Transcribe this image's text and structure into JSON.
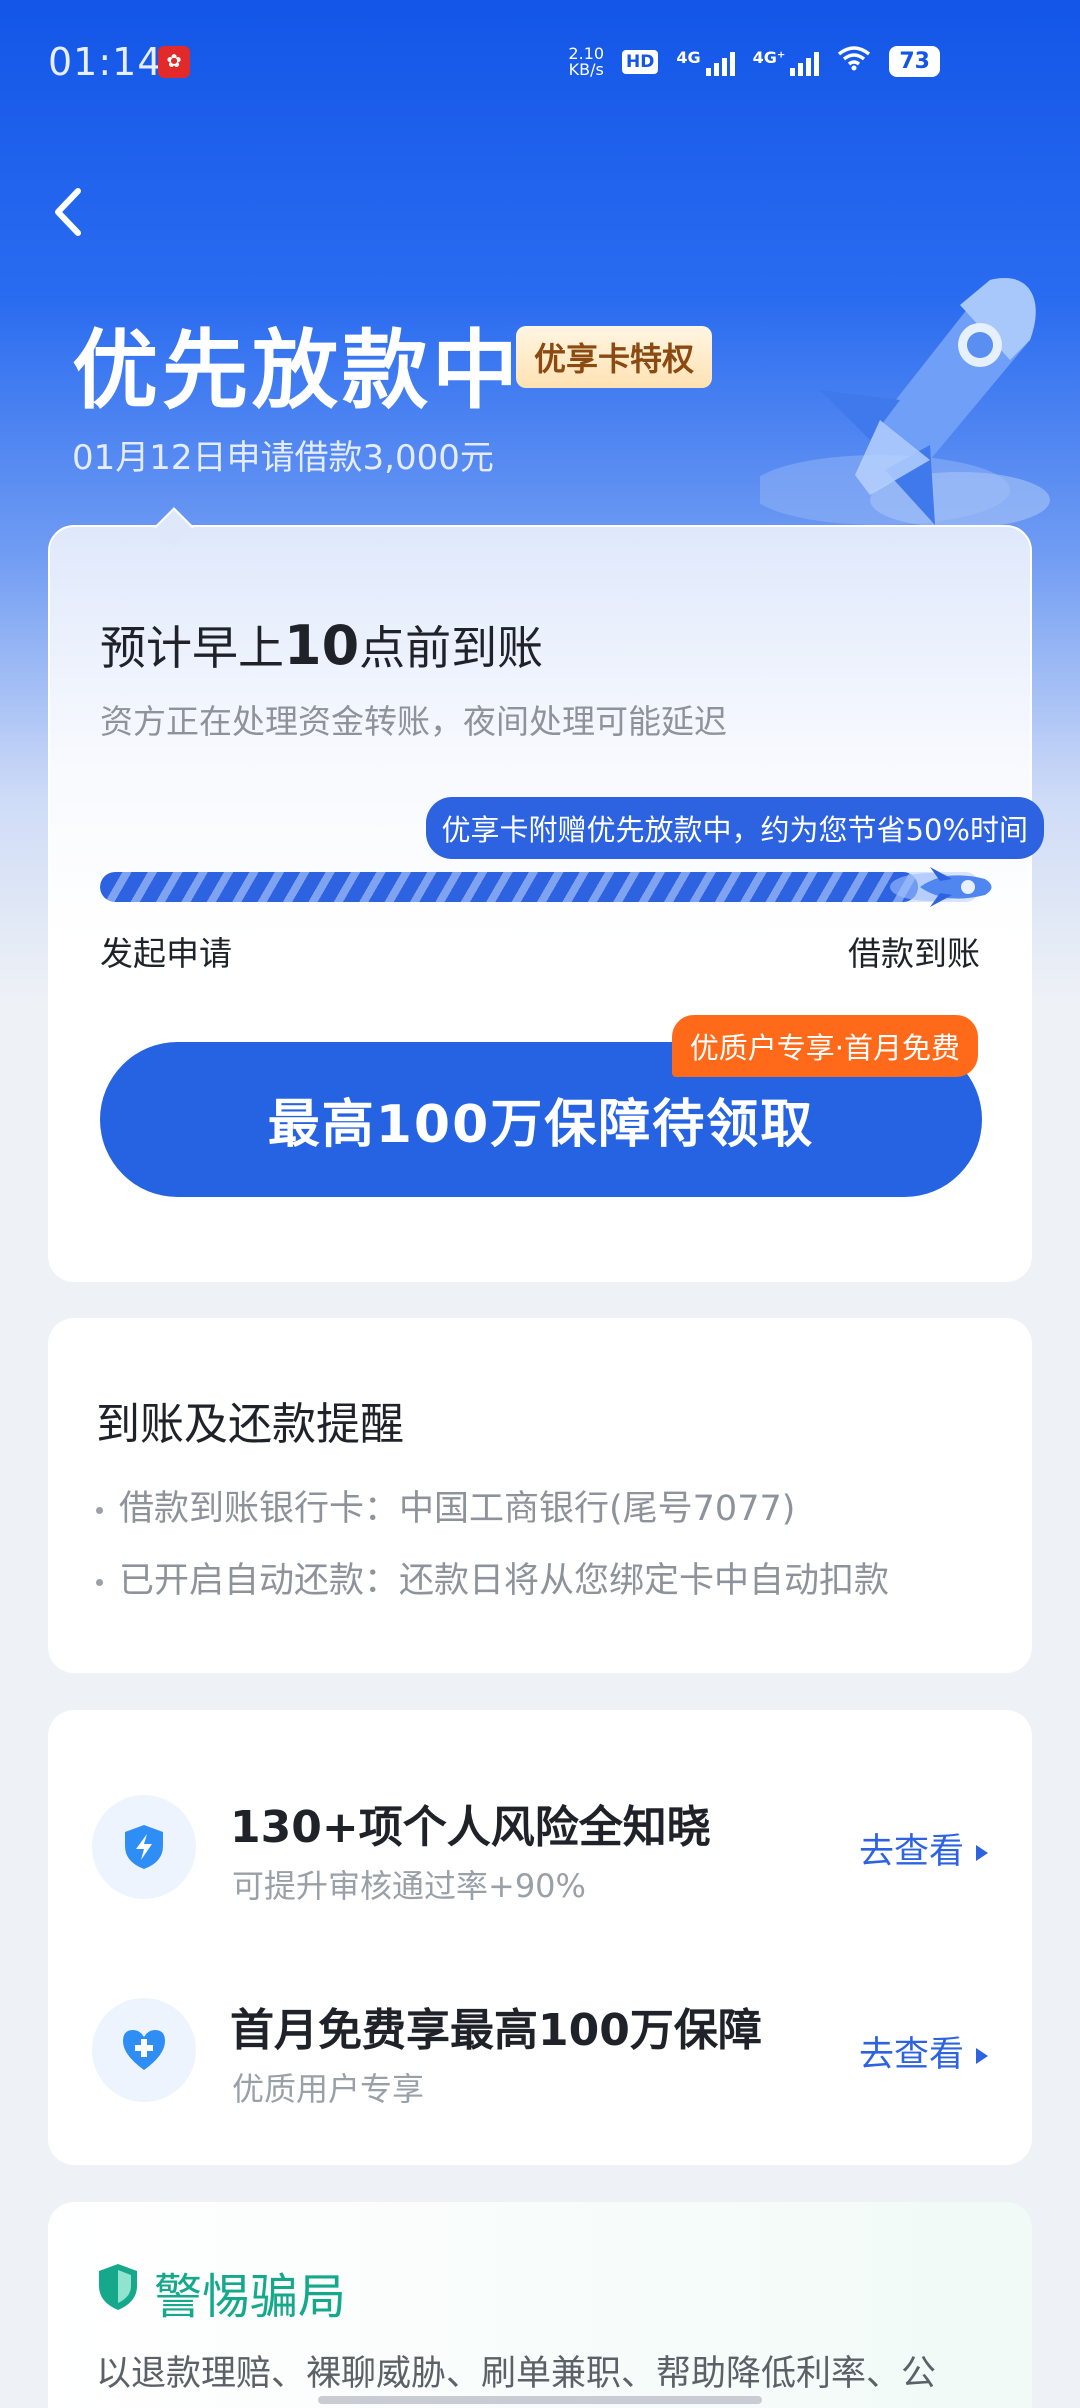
{
  "status_bar": {
    "time": "01:14",
    "net_speed_value": "2.10",
    "net_speed_unit": "KB/s",
    "hd_label": "HD",
    "sim1_label": "4G",
    "sim2_label": "4G⁺",
    "battery": "73"
  },
  "header": {
    "title": "优先放款中",
    "badge": "优享卡特权",
    "subtitle": "01月12日申请借款3,000元"
  },
  "progress_card": {
    "eta_prefix": "预计早上",
    "eta_hour": "10",
    "eta_suffix": "点前到账",
    "eta_sub": "资方正在处理资金转账，夜间处理可能延迟",
    "save_tip": "优享卡附赠优先放款中，约为您节省50%时间",
    "progress_fraction": 0.93,
    "start_label": "发起申请",
    "end_label": "借款到账",
    "promo_tag": "优质户专享·首月免费",
    "claim_button": "最高100万保障待领取"
  },
  "reminder_card": {
    "title": "到账及还款提醒",
    "items": [
      "借款到账银行卡：中国工商银行(尾号7077)",
      "已开启自动还款：还款日将从您绑定卡中自动扣款"
    ]
  },
  "services": [
    {
      "icon": "shield-lightning-icon",
      "title": "130+项个人风险全知晓",
      "sub": "可提升审核通过率+90%",
      "link": "去查看"
    },
    {
      "icon": "heart-plus-icon",
      "title": "首月免费享最高100万保障",
      "sub": "优质用户专享",
      "link": "去查看"
    }
  ],
  "warning_card": {
    "title": "警惕骗局",
    "text": "以退款理赔、裸聊威胁、刷单兼职、帮助降低利率、公"
  },
  "colors": {
    "primary": "#2563e3",
    "accent_orange": "#ff6a1a",
    "warning_green": "#15a88a"
  }
}
